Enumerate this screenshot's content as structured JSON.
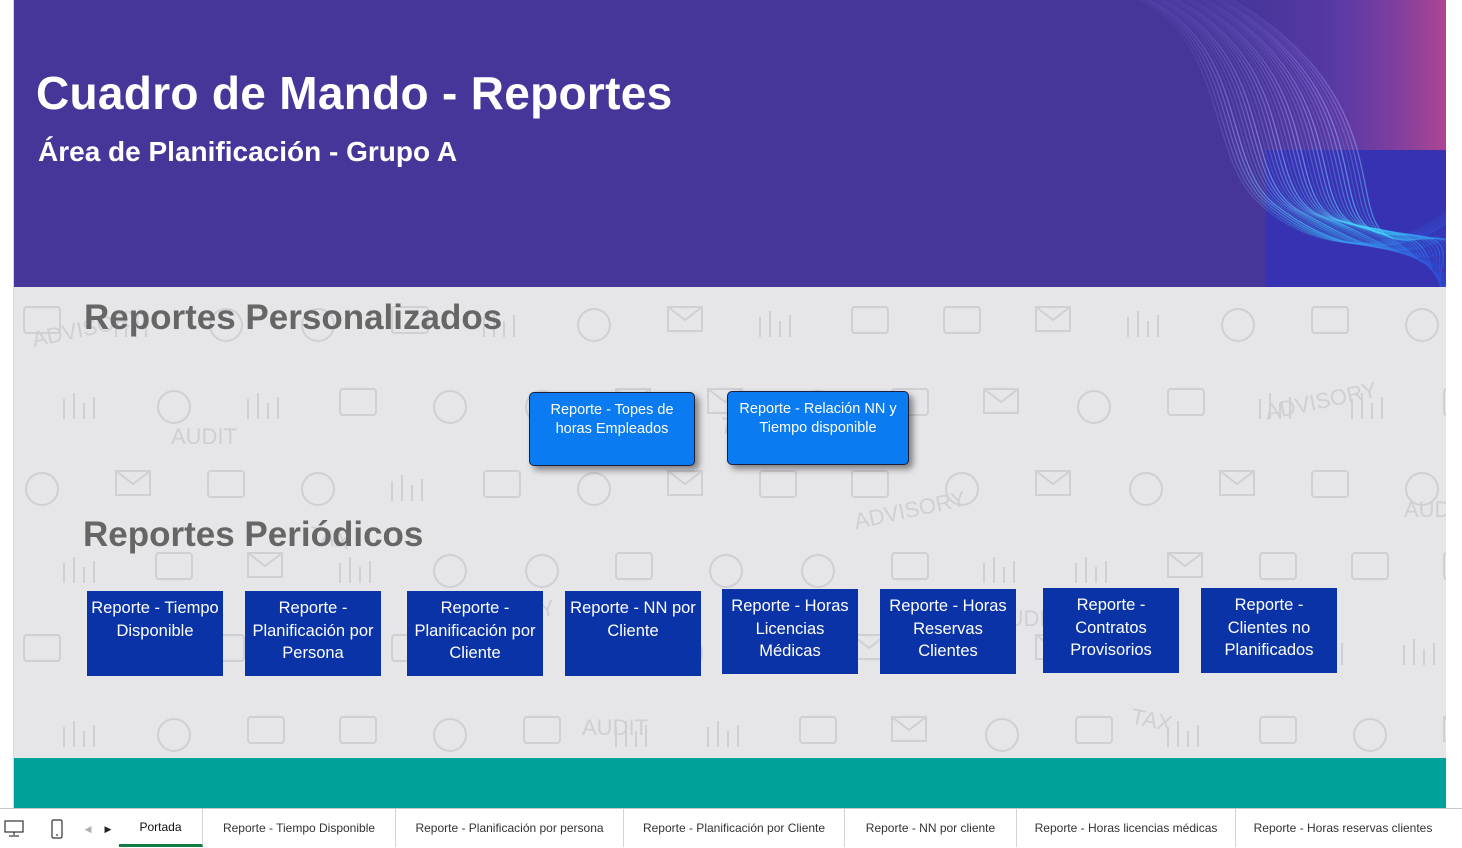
{
  "header": {
    "title": "Cuadro de Mando - Reportes",
    "subtitle": "Área de Planificación - Grupo A"
  },
  "sections": {
    "personalizados": {
      "heading": "Reportes Personalizados",
      "buttons": [
        "Reporte - Topes de horas Empleados",
        "Reporte - Relación NN y Tiempo disponible"
      ]
    },
    "periodicos": {
      "heading": "Reportes Periódicos",
      "buttons": [
        "Reporte - Tiempo Disponible",
        "Reporte - Planificación por Persona",
        "Reporte - Planificación por Cliente",
        "Reporte - NN por Cliente",
        "Reporte - Horas Licencias Médicas",
        "Reporte - Horas Reservas Clientes",
        "Reporte - Contratos Provisorios",
        "Reporte - Clientes no Planificados"
      ]
    }
  },
  "background_words": [
    "ADVISORY",
    "AUDIT",
    "TAX"
  ],
  "sheet_tabs": [
    "Portada",
    "Reporte - Tiempo Disponible",
    "Reporte - Planificación por persona",
    "Reporte - Planificación por Cliente",
    "Reporte - NN por cliente",
    "Reporte - Horas licencias médicas",
    "Reporte - Horas reservas clientes"
  ],
  "active_tab": "Portada",
  "icons": {
    "normal_view": "desktop-monitor-icon",
    "mobile_view": "mobile-phone-icon",
    "scroll_left": "triangle-left-icon",
    "scroll_right": "triangle-right-icon"
  },
  "colors": {
    "header_bg": "#46369a",
    "custom_button": "#0a7bf0",
    "periodic_button": "#0a33a8",
    "footer_band": "#00a19a",
    "heading_text": "#666666",
    "active_tab_underline": "#107c41"
  }
}
